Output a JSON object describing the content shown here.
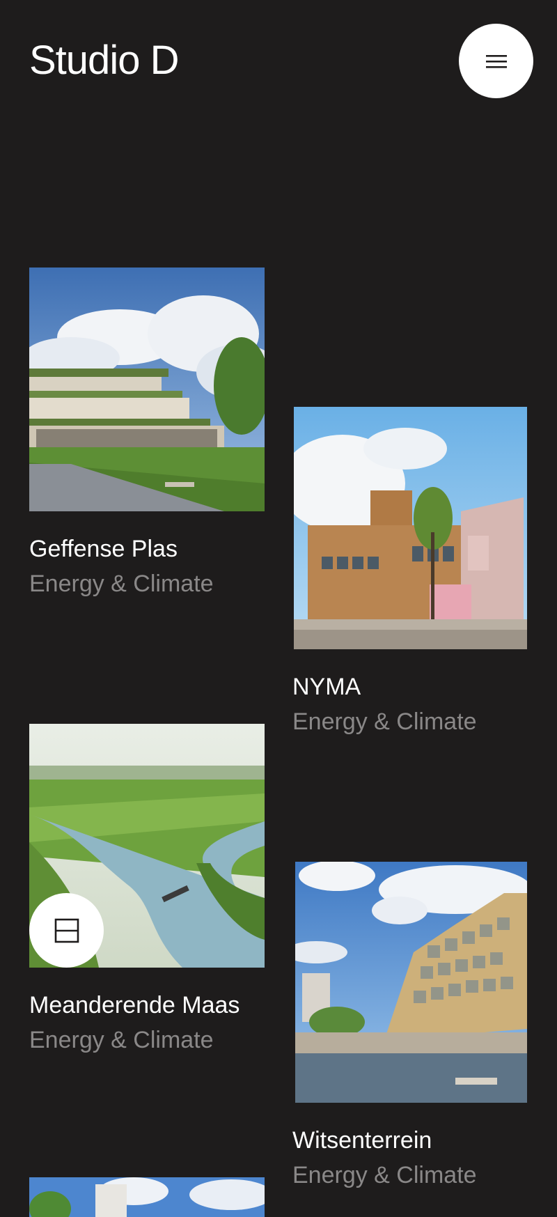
{
  "header": {
    "logo_text": "Studio D",
    "menu_icon": "hamburger-menu-icon"
  },
  "projects": [
    {
      "title": "Geffense Plas",
      "category": "Energy & Climate"
    },
    {
      "title": "NYMA",
      "category": "Energy & Climate"
    },
    {
      "title": "Meanderende Maas",
      "category": "Energy & Climate"
    },
    {
      "title": "Witsenterrein",
      "category": "Energy & Climate"
    }
  ],
  "floating": {
    "layout_icon": "grid-layout-icon"
  },
  "colors": {
    "background": "#1e1c1c",
    "text": "#ffffff",
    "muted": "#8a8888"
  }
}
